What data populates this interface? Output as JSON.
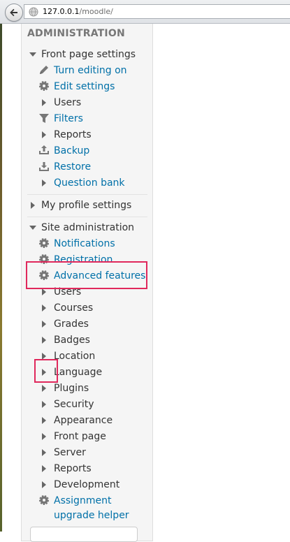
{
  "browser": {
    "url_host": "127.0.0.1",
    "url_path": "/moodle/"
  },
  "admin_block": {
    "title": "ADMINISTRATION",
    "front_page_settings": {
      "label": "Front page settings",
      "items": [
        {
          "label": "Turn editing on",
          "icon": "pencil-icon",
          "link": true
        },
        {
          "label": "Edit settings",
          "icon": "gear-icon",
          "link": true
        },
        {
          "label": "Users",
          "icon": "triangle-right-icon",
          "link": false
        },
        {
          "label": "Filters",
          "icon": "funnel-icon",
          "link": true
        },
        {
          "label": "Reports",
          "icon": "triangle-right-icon",
          "link": false
        },
        {
          "label": "Backup",
          "icon": "upload-icon",
          "link": true
        },
        {
          "label": "Restore",
          "icon": "download-icon",
          "link": true
        },
        {
          "label": "Question bank",
          "icon": "triangle-right-icon",
          "link": true
        }
      ]
    },
    "my_profile_settings": {
      "label": "My profile settings"
    },
    "site_administration": {
      "label": "Site administration",
      "items": [
        {
          "label": "Notifications",
          "icon": "gear-icon",
          "link": true
        },
        {
          "label": "Registration",
          "icon": "gear-icon",
          "link": true
        },
        {
          "label": "Advanced features",
          "icon": "gear-icon",
          "link": true
        },
        {
          "label": "Users",
          "icon": "triangle-right-icon",
          "link": false
        },
        {
          "label": "Courses",
          "icon": "triangle-right-icon",
          "link": false
        },
        {
          "label": "Grades",
          "icon": "triangle-right-icon",
          "link": false
        },
        {
          "label": "Badges",
          "icon": "triangle-right-icon",
          "link": false
        },
        {
          "label": "Location",
          "icon": "triangle-right-icon",
          "link": false
        },
        {
          "label": "Language",
          "icon": "triangle-right-icon",
          "link": false
        },
        {
          "label": "Plugins",
          "icon": "triangle-right-icon",
          "link": false
        },
        {
          "label": "Security",
          "icon": "triangle-right-icon",
          "link": false
        },
        {
          "label": "Appearance",
          "icon": "triangle-right-icon",
          "link": false
        },
        {
          "label": "Front page",
          "icon": "triangle-right-icon",
          "link": false
        },
        {
          "label": "Server",
          "icon": "triangle-right-icon",
          "link": false
        },
        {
          "label": "Reports",
          "icon": "triangle-right-icon",
          "link": false
        },
        {
          "label": "Development",
          "icon": "triangle-right-icon",
          "link": false
        },
        {
          "label": "Assignment",
          "icon": "gear-icon",
          "link": true
        },
        {
          "label": "upgrade helper",
          "icon": "",
          "link": true
        }
      ]
    }
  },
  "colors": {
    "link": "#0070a8",
    "text": "#333333",
    "highlight": "#e0285c",
    "block_bg": "#f5f5f5"
  }
}
